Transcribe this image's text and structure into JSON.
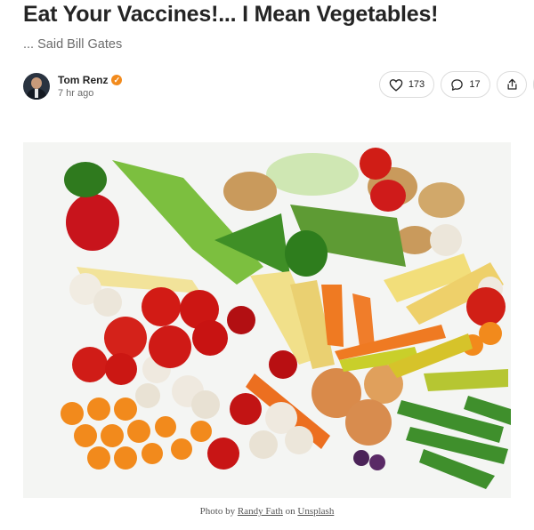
{
  "article": {
    "title": "Eat Your Vaccines!... I Mean Vegetables!",
    "subtitle": "... Said Bill Gates"
  },
  "author": {
    "name": "Tom Renz",
    "time": "7 hr ago",
    "verified_icon": "check-badge-icon",
    "badge_color": "#f28b1d"
  },
  "actions": {
    "likes": "173",
    "comments": "17",
    "like_icon": "heart-icon",
    "comment_icon": "speech-bubble-icon",
    "share_icon": "share-icon"
  },
  "photo": {
    "caption_prefix": "Photo by",
    "photographer": "Randy Fath",
    "caption_mid": "on",
    "source": "Unsplash"
  }
}
